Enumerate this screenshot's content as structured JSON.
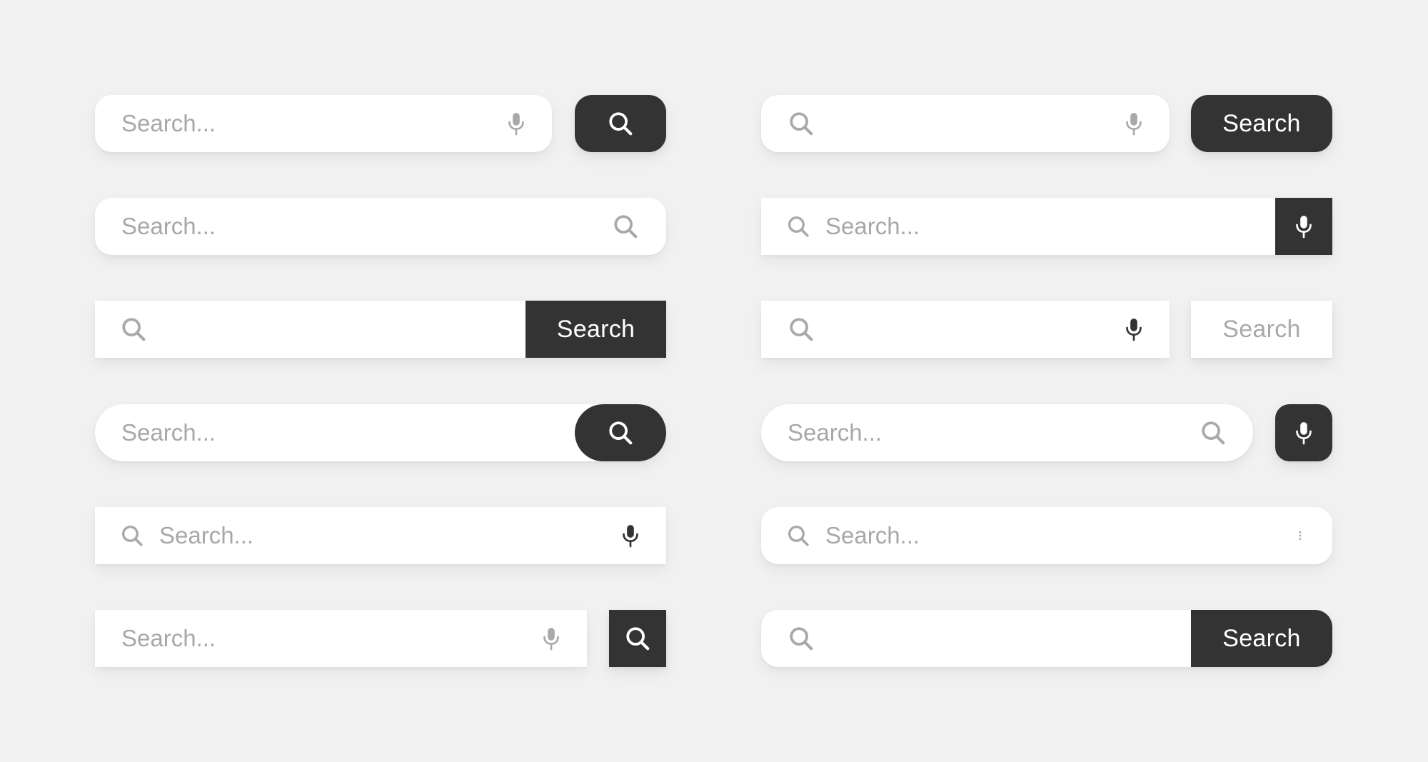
{
  "placeholder": "Search...",
  "search_label": "Search",
  "colors": {
    "background": "#f1f1f1",
    "bar": "#ffffff",
    "button_dark": "#333333",
    "icon_light": "#a9a9a9",
    "placeholder": "#a8a8a8"
  },
  "icons": [
    "search-icon",
    "microphone-icon",
    "more-vertical-icon"
  ]
}
